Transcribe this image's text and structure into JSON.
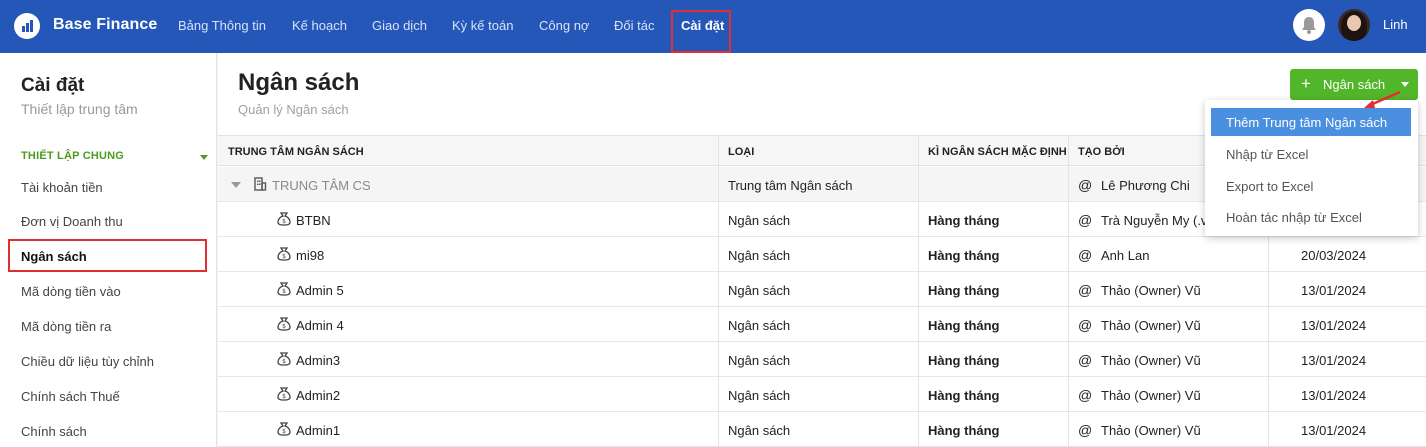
{
  "app": {
    "brand": "Base Finance",
    "user_name": "Linh"
  },
  "nav": {
    "items": [
      "Bảng Thông tin",
      "Kế hoạch",
      "Giao dịch",
      "Kỳ kế toán",
      "Công nợ",
      "Đối tác"
    ],
    "active": "Cài đặt"
  },
  "sidebar": {
    "title": "Cài đặt",
    "subtitle": "Thiết lập trung tâm",
    "section": "THIẾT LẬP CHUNG",
    "items": [
      "Tài khoản tiền",
      "Đơn vị Doanh thu",
      "Ngân sách",
      "Mã dòng tiền vào",
      "Mã dòng tiền ra",
      "Chiều dữ liệu tùy chỉnh",
      "Chính sách Thuế",
      "Chính sách"
    ],
    "active_item": "Ngân sách"
  },
  "page": {
    "title": "Ngân sách",
    "subtitle": "Quản lý Ngân sách",
    "add_button": "Ngân sách"
  },
  "table": {
    "headers": [
      "TRUNG TÂM NGÂN SÁCH",
      "LOẠI",
      "KÌ NGÂN SÁCH MẶC ĐỊNH",
      "TẠO BỞI"
    ],
    "group": {
      "name": "TRUNG TÂM CS",
      "type": "Trung tâm Ngân sách",
      "period": "",
      "creator": "Lê Phương Chi",
      "date": ""
    },
    "rows": [
      {
        "name": "BTBN",
        "type": "Ngân sách",
        "period": "Hàng tháng",
        "creator": "Trà Nguyễn My (.v",
        "date": ""
      },
      {
        "name": "mi98",
        "type": "Ngân sách",
        "period": "Hàng tháng",
        "creator": "Anh Lan",
        "date": "20/03/2024"
      },
      {
        "name": "Admin 5",
        "type": "Ngân sách",
        "period": "Hàng tháng",
        "creator": "Thảo (Owner) Vũ",
        "date": "13/01/2024"
      },
      {
        "name": "Admin 4",
        "type": "Ngân sách",
        "period": "Hàng tháng",
        "creator": "Thảo (Owner) Vũ",
        "date": "13/01/2024"
      },
      {
        "name": "Admin3",
        "type": "Ngân sách",
        "period": "Hàng tháng",
        "creator": "Thảo (Owner) Vũ",
        "date": "13/01/2024"
      },
      {
        "name": "Admin2",
        "type": "Ngân sách",
        "period": "Hàng tháng",
        "creator": "Thảo (Owner) Vũ",
        "date": "13/01/2024"
      },
      {
        "name": "Admin1",
        "type": "Ngân sách",
        "period": "Hàng tháng",
        "creator": "Thảo (Owner) Vũ",
        "date": "13/01/2024"
      }
    ]
  },
  "dropdown": {
    "items": [
      "Thêm Trung tâm Ngân sách",
      "Nhập từ Excel",
      "Export to Excel",
      "Hoàn tác nhập từ Excel"
    ],
    "highlighted": "Thêm Trung tâm Ngân sách"
  },
  "colors": {
    "topbar": "#2557b8",
    "accent_green": "#52b62a",
    "highlight_red": "#e02f2f",
    "menu_highlight": "#4a8fe0"
  },
  "icons": [
    "logo-icon",
    "bell-icon",
    "caret-down-icon",
    "plus-icon",
    "building-icon",
    "money-bag-icon",
    "at-icon"
  ]
}
